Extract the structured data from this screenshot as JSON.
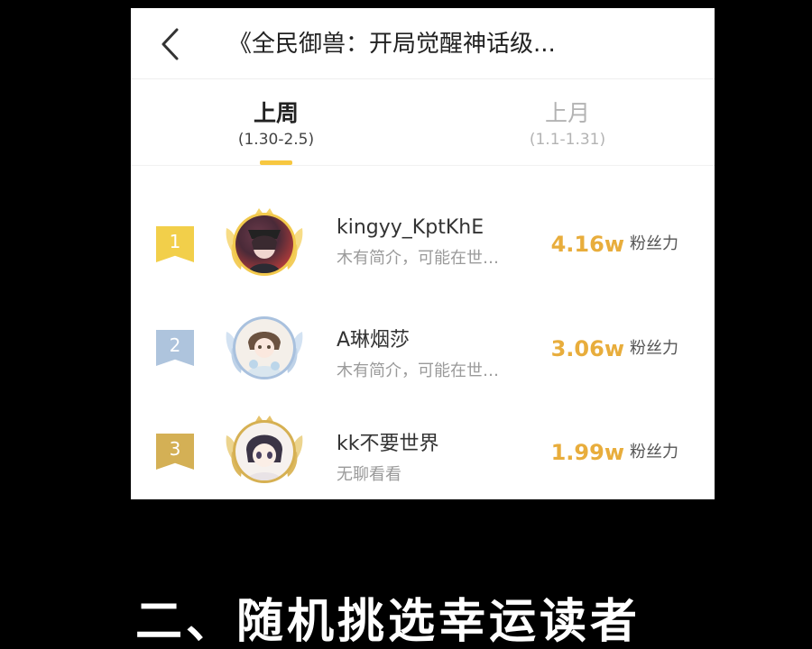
{
  "header": {
    "title": "《全民御兽：开局觉醒神话级..."
  },
  "tabs": [
    {
      "label": "上周",
      "date": "(1.30-2.5)",
      "active": true
    },
    {
      "label": "上月",
      "date": "(1.1-1.31)",
      "active": false
    }
  ],
  "ranking": [
    {
      "rank": "1",
      "name": "kingyy_KptKhE",
      "bio": "木有简介，可能在世…",
      "fans": "4.16w",
      "fans_label": "粉丝力",
      "badge_color": "#f2cf4a"
    },
    {
      "rank": "2",
      "name": "A琳烟莎",
      "bio": "木有简介，可能在世…",
      "fans": "3.06w",
      "fans_label": "粉丝力",
      "badge_color": "#aec4dd"
    },
    {
      "rank": "3",
      "name": "kk不要世界",
      "bio": "无聊看看",
      "fans": "1.99w",
      "fans_label": "粉丝力",
      "badge_color": "#d4b055"
    }
  ],
  "caption": "二、随机挑选幸运读者",
  "colors": {
    "accent": "#f7c740",
    "fans": "#e8ad3c",
    "background": "#000000"
  }
}
